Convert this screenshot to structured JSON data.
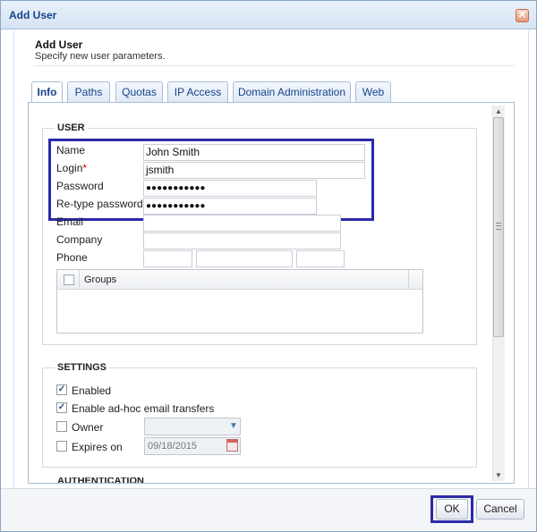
{
  "window": {
    "title": "Add User",
    "close_icon": "close-icon"
  },
  "header": {
    "title": "Add User",
    "description": "Specify new user parameters."
  },
  "tabs": [
    {
      "label": "Info",
      "active": true
    },
    {
      "label": "Paths"
    },
    {
      "label": "Quotas"
    },
    {
      "label": "IP Access"
    },
    {
      "label": "Domain Administration"
    },
    {
      "label": "Web"
    }
  ],
  "user_section": {
    "legend": "USER",
    "name_label": "Name",
    "name_value": "John Smith",
    "login_label": "Login",
    "login_required": "*",
    "login_value": "jsmith",
    "password_label": "Password",
    "password_value": "●●●●●●●●●●●",
    "retype_label": "Re-type password",
    "retype_value": "●●●●●●●●●●●",
    "email_label": "Email",
    "email_value": "",
    "company_label": "Company",
    "company_value": "",
    "phone_label": "Phone",
    "phone_values": [
      "",
      "",
      ""
    ],
    "groups_header": "Groups"
  },
  "settings_section": {
    "legend": "SETTINGS",
    "enabled_label": "Enabled",
    "enabled_checked": true,
    "adhoc_label": "Enable ad-hoc email transfers",
    "adhoc_checked": true,
    "owner_label": "Owner",
    "owner_checked": false,
    "owner_value": "",
    "expires_label": "Expires on",
    "expires_checked": false,
    "expires_value": "09/18/2015"
  },
  "authentication_section": {
    "legend": "AUTHENTICATION"
  },
  "footer": {
    "ok_label": "OK",
    "cancel_label": "Cancel"
  },
  "colors": {
    "accent": "#15428b",
    "highlight": "#2b2aa8",
    "required": "#cc0000"
  }
}
